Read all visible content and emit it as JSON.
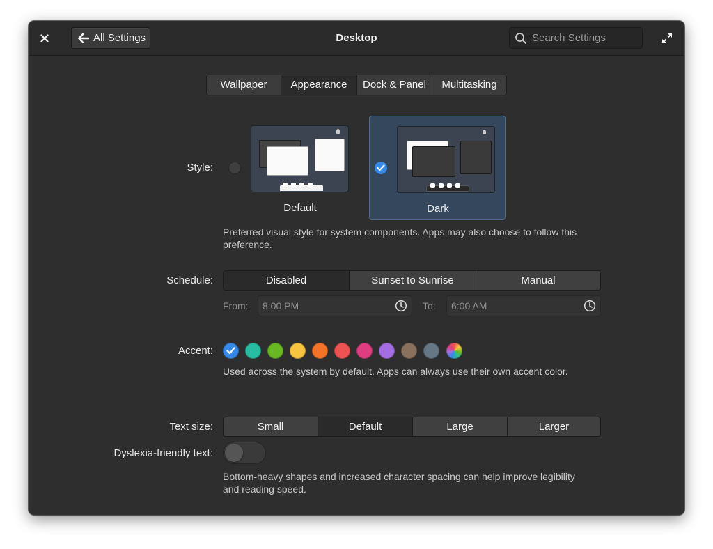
{
  "window": {
    "title": "Desktop",
    "back_label": "All Settings",
    "search_placeholder": "Search Settings"
  },
  "tabs": [
    {
      "label": "Wallpaper",
      "active": false
    },
    {
      "label": "Appearance",
      "active": true
    },
    {
      "label": "Dock & Panel",
      "active": false
    },
    {
      "label": "Multitasking",
      "active": false
    }
  ],
  "style": {
    "label": "Style:",
    "options": [
      {
        "name": "Default",
        "selected": false
      },
      {
        "name": "Dark",
        "selected": true
      }
    ],
    "description": "Preferred visual style for system components. Apps may also choose to follow this preference."
  },
  "schedule": {
    "label": "Schedule:",
    "options": [
      {
        "label": "Disabled",
        "active": true
      },
      {
        "label": "Sunset to Sunrise",
        "active": false
      },
      {
        "label": "Manual",
        "active": false
      }
    ],
    "from_label": "From:",
    "from_value": "8:00 PM",
    "to_label": "To:",
    "to_value": "6:00 AM"
  },
  "accent": {
    "label": "Accent:",
    "colors": [
      {
        "name": "blue",
        "hex": "#3689e6",
        "selected": true
      },
      {
        "name": "mint",
        "hex": "#28bca3",
        "selected": false
      },
      {
        "name": "green",
        "hex": "#68b723",
        "selected": false
      },
      {
        "name": "yellow",
        "hex": "#f9c440",
        "selected": false
      },
      {
        "name": "orange",
        "hex": "#f37329",
        "selected": false
      },
      {
        "name": "red",
        "hex": "#ed5353",
        "selected": false
      },
      {
        "name": "pink",
        "hex": "#de3e80",
        "selected": false
      },
      {
        "name": "purple",
        "hex": "#a56de2",
        "selected": false
      },
      {
        "name": "brown",
        "hex": "#8a715e",
        "selected": false
      },
      {
        "name": "gray",
        "hex": "#667885",
        "selected": false
      },
      {
        "name": "auto",
        "hex": "conic",
        "selected": false
      }
    ],
    "description": "Used across the system by default. Apps can always use their own accent color."
  },
  "text_size": {
    "label": "Text size:",
    "options": [
      {
        "label": "Small",
        "active": false
      },
      {
        "label": "Default",
        "active": true
      },
      {
        "label": "Large",
        "active": false
      },
      {
        "label": "Larger",
        "active": false
      }
    ]
  },
  "dyslexia": {
    "label": "Dyslexia-friendly text:",
    "enabled": false,
    "description": "Bottom-heavy shapes and increased character spacing can help improve legibility and reading speed."
  },
  "icons": {
    "close": "close-icon",
    "back": "arrow-left-icon",
    "search": "search-icon",
    "maximize": "maximize-icon",
    "check": "check-icon",
    "clock": "clock-icon"
  }
}
